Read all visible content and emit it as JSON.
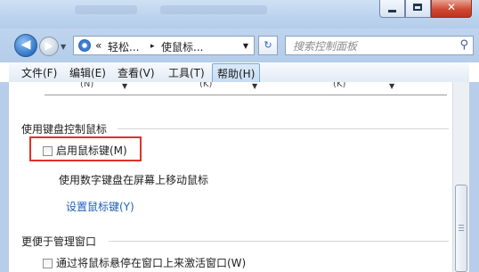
{
  "window": {
    "minimize_glyph": "",
    "close_glyph": "✕"
  },
  "nav": {
    "back_arrow": "◀",
    "forward_arrow": "▶",
    "dropdown_arrow": "▼"
  },
  "address": {
    "chevron": "«",
    "crumb1": "轻松...",
    "separator": "▸",
    "crumb2": "使鼠标...",
    "dropdown_arrow": "▼"
  },
  "refresh_glyph": "↻",
  "search": {
    "placeholder": "搜索控制面板",
    "icon": "⚲"
  },
  "menu": {
    "items": [
      "文件(F)",
      "编辑(E)",
      "查看(V)",
      "工具(T)",
      "帮助(H)"
    ],
    "highlighted_index": 4
  },
  "remnants": {
    "label_a": "(N)",
    "label_b": "(K)",
    "label_c": "(K)"
  },
  "keyboard_section": {
    "title": "使用键盘控制鼠标",
    "checkbox_label": "启用鼠标键(M)",
    "checked": false,
    "description": "使用数字键盘在屏幕上移动鼠标",
    "link": "设置鼠标键(Y)"
  },
  "window_section": {
    "title": "更便于管理窗口",
    "checkbox_label": "通过将鼠标悬停在窗口上来激活窗口(W)",
    "checked": false
  },
  "colors": {
    "highlight_border": "#e0312b",
    "link": "#1f5fb9",
    "frame": "#b7cde9"
  }
}
